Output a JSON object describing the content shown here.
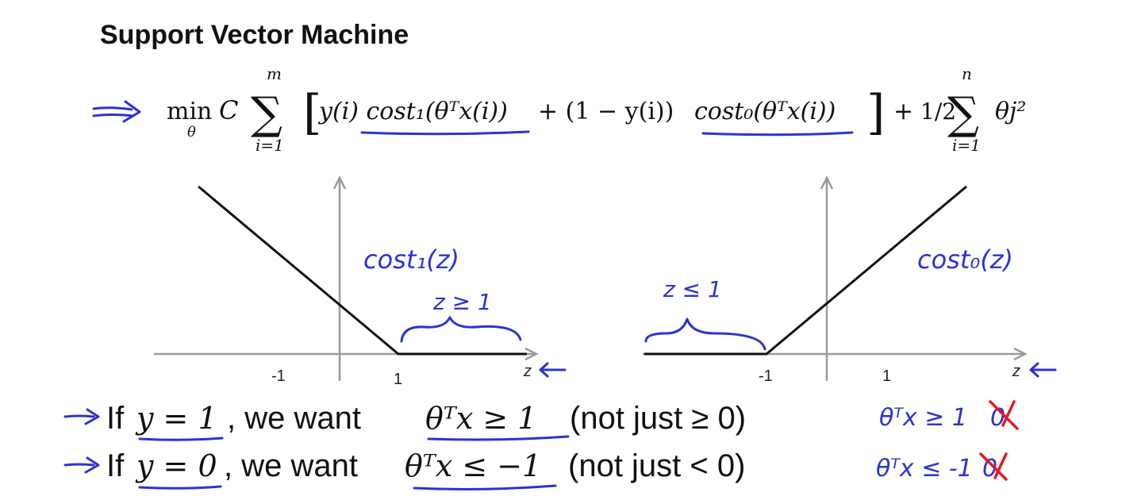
{
  "title": "Support Vector Machine",
  "formula": {
    "min": "min",
    "min_sub": "θ",
    "C": "C",
    "sigma": "∑",
    "sum_top": "m",
    "sum_bottom": "i=1",
    "lbracket": "[",
    "term1": "y(i) cost₁(θᵀx(i))",
    "plus_mid": "+ (1 − y(i))",
    "term2": "cost₀(θᵀx(i))",
    "rbracket": "]",
    "plus_half": "+",
    "half": "1/2",
    "sigma2": "∑",
    "sum2_top": "n",
    "sum2_bottom": "i=1",
    "theta_j": "θj²"
  },
  "left_plot": {
    "label": "cost₁(z)",
    "range_note": "z ≥ 1",
    "tick_neg": "-1",
    "tick_pos": "1",
    "axis_var": "z"
  },
  "right_plot": {
    "label": "cost₀(z)",
    "range_note": "z ≤ 1",
    "tick_neg": "-1",
    "tick_pos": "1",
    "axis_var": "z"
  },
  "line1": {
    "prefix": "If",
    "condition": "y = 1",
    "middle": ", we want",
    "want": "θᵀx ≥ 1",
    "aside": "(not just ≥ 0)",
    "note": "θᵀx ≥ 1",
    "struck": "0"
  },
  "line2": {
    "prefix": "If",
    "condition": "y = 0",
    "middle": ", we want",
    "want": "θᵀx ≤ −1",
    "aside": "(not just < 0)",
    "note": "θᵀx ≤ -1",
    "struck": "0"
  },
  "colors": {
    "ink_blue": "#2b33d6",
    "ink_red": "#e01a2a",
    "curve": "#111111",
    "axis": "#9a9a9a"
  }
}
